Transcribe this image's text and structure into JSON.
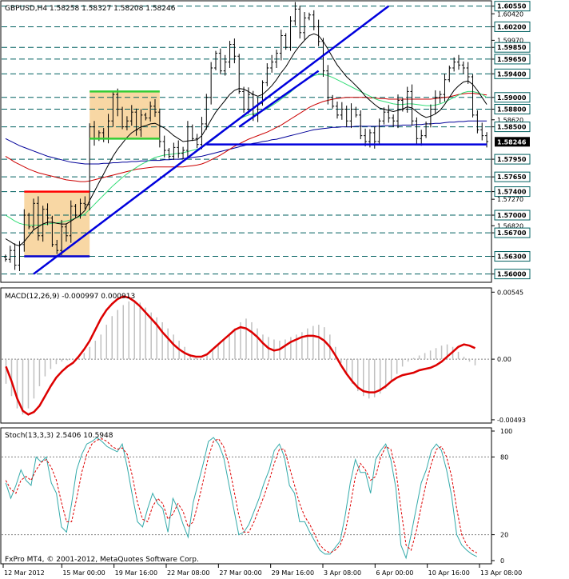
{
  "chart_data": [
    {
      "type": "candlestick",
      "symbol_label": "GBPUSD,H4",
      "ohlc_label": "1.58258 1.58327 1.58208 1.58246",
      "current_price": 1.58246,
      "current_label": "1.58246",
      "ylim": [
        1.559,
        1.606
      ],
      "y_ticks": [
        {
          "v": 1.6055,
          "label": "1.60550",
          "box": true
        },
        {
          "v": 1.6042,
          "label": "1.60420",
          "box": false
        },
        {
          "v": 1.602,
          "label": "1.60200",
          "box": true
        },
        {
          "v": 1.5997,
          "label": "1.59970",
          "box": false
        },
        {
          "v": 1.5985,
          "label": "1.59850",
          "box": true
        },
        {
          "v": 1.5965,
          "label": "1.59650",
          "box": true
        },
        {
          "v": 1.594,
          "label": "1.59400",
          "box": true
        },
        {
          "v": 1.59,
          "label": "1.59000",
          "box": true
        },
        {
          "v": 1.588,
          "label": "1.58800",
          "box": true
        },
        {
          "v": 1.5862,
          "label": "1.58620",
          "box": false
        },
        {
          "v": 1.585,
          "label": "1.58500",
          "box": true
        },
        {
          "v": 1.5795,
          "label": "1.57950",
          "box": true
        },
        {
          "v": 1.5765,
          "label": "1.57650",
          "box": true
        },
        {
          "v": 1.574,
          "label": "1.57400",
          "box": true
        },
        {
          "v": 1.5727,
          "label": "1.57270",
          "box": false
        },
        {
          "v": 1.57,
          "label": "1.57000",
          "box": true
        },
        {
          "v": 1.5682,
          "label": "1.56820",
          "box": false
        },
        {
          "v": 1.567,
          "label": "1.56700",
          "box": true
        },
        {
          "v": 1.563,
          "label": "1.56300",
          "box": true
        },
        {
          "v": 1.56,
          "label": "1.56000",
          "box": true
        }
      ],
      "horizontal_levels": [
        1.6055,
        1.602,
        1.5985,
        1.5965,
        1.594,
        1.59,
        1.588,
        1.585,
        1.5795,
        1.5765,
        1.574,
        1.57,
        1.567,
        1.563,
        1.56
      ],
      "support_line": {
        "from_bar": 43,
        "to_bar": 103,
        "price": 1.582
      },
      "trendlines": [
        {
          "bar1": 6,
          "p1": 1.56,
          "bar2": 82,
          "p2": 1.6055
        },
        {
          "bar1": 50,
          "p1": 1.585,
          "bar2": 67,
          "p2": 1.5945
        }
      ],
      "boxes": [
        {
          "bar1": 4,
          "bar2": 18,
          "top": 1.574,
          "bottom": 1.563,
          "top_color": "#ff0000",
          "bottom_color": "#0000cc"
        },
        {
          "bar1": 18,
          "bar2": 33,
          "top": 1.591,
          "bottom": 1.583,
          "top_color": "#33cc33",
          "bottom_color": "#33cc33"
        }
      ],
      "closes": [
        1.5625,
        1.564,
        1.5615,
        1.565,
        1.57,
        1.568,
        1.572,
        1.5665,
        1.571,
        1.5695,
        1.565,
        1.564,
        1.568,
        1.5665,
        1.5715,
        1.57,
        1.572,
        1.5718,
        1.585,
        1.583,
        1.584,
        1.583,
        1.586,
        1.5905,
        1.588,
        1.585,
        1.586,
        1.5875,
        1.5845,
        1.587,
        1.5865,
        1.5885,
        1.5875,
        1.5825,
        1.581,
        1.58,
        1.5815,
        1.5805,
        1.581,
        1.585,
        1.583,
        1.582,
        1.5855,
        1.59,
        1.595,
        1.5975,
        1.5945,
        1.596,
        1.599,
        1.597,
        1.591,
        1.588,
        1.5905,
        1.587,
        1.589,
        1.5925,
        1.595,
        1.596,
        1.5975,
        1.6005,
        1.5985,
        1.603,
        1.605,
        1.601,
        1.6035,
        1.604,
        1.602,
        1.5995,
        1.5945,
        1.59,
        1.5885,
        1.587,
        1.588,
        1.586,
        1.588,
        1.587,
        1.5835,
        1.5825,
        1.584,
        1.5825,
        1.586,
        1.5875,
        1.5865,
        1.586,
        1.5895,
        1.588,
        1.591,
        1.586,
        1.583,
        1.5835,
        1.5855,
        1.588,
        1.59,
        1.5905,
        1.593,
        1.595,
        1.596,
        1.5955,
        1.595,
        1.5935,
        1.587,
        1.5845,
        1.5835,
        1.5825
      ],
      "ma_fast": [
        1.566,
        1.5655,
        1.565,
        1.5648,
        1.5655,
        1.5665,
        1.5675,
        1.568,
        1.5685,
        1.5688,
        1.5688,
        1.5686,
        1.5685,
        1.5685,
        1.569,
        1.5695,
        1.57,
        1.5708,
        1.5725,
        1.574,
        1.5755,
        1.577,
        1.5785,
        1.58,
        1.5812,
        1.5822,
        1.5832,
        1.584,
        1.5845,
        1.585,
        1.5852,
        1.5855,
        1.5856,
        1.5852,
        1.5848,
        1.5842,
        1.5835,
        1.583,
        1.5825,
        1.5826,
        1.5827,
        1.5828,
        1.5835,
        1.5848,
        1.5862,
        1.5875,
        1.5885,
        1.5895,
        1.5905,
        1.5912,
        1.5915,
        1.5914,
        1.591,
        1.5905,
        1.5902,
        1.5905,
        1.5912,
        1.592,
        1.593,
        1.5942,
        1.5952,
        1.5965,
        1.5978,
        1.5988,
        1.5997,
        1.6005,
        1.6008,
        1.6005,
        1.5995,
        1.5982,
        1.5968,
        1.5955,
        1.5945,
        1.5935,
        1.5928,
        1.592,
        1.5912,
        1.5902,
        1.5895,
        1.5888,
        1.5882,
        1.588,
        1.5878,
        1.5876,
        1.5878,
        1.588,
        1.5884,
        1.5882,
        1.5876,
        1.587,
        1.5866,
        1.5868,
        1.5872,
        1.5878,
        1.5888,
        1.59,
        1.5912,
        1.592,
        1.5926,
        1.5928,
        1.5922,
        1.5912,
        1.59,
        1.5888
      ],
      "ma_mid": [
        1.57,
        1.5695,
        1.569,
        1.5686,
        1.5684,
        1.5683,
        1.5683,
        1.5683,
        1.5684,
        1.5685,
        1.5686,
        1.5687,
        1.5688,
        1.569,
        1.5692,
        1.5695,
        1.5698,
        1.5702,
        1.571,
        1.5718,
        1.5726,
        1.5734,
        1.5742,
        1.575,
        1.5757,
        1.5764,
        1.577,
        1.5776,
        1.5781,
        1.5786,
        1.579,
        1.5794,
        1.5798,
        1.58,
        1.5802,
        1.5803,
        1.5804,
        1.5805,
        1.5806,
        1.5808,
        1.581,
        1.5812,
        1.5815,
        1.582,
        1.5826,
        1.5832,
        1.5838,
        1.5845,
        1.5852,
        1.5858,
        1.5863,
        1.5867,
        1.587,
        1.5872,
        1.5874,
        1.5877,
        1.5881,
        1.5886,
        1.5891,
        1.5897,
        1.5903,
        1.5909,
        1.5916,
        1.5922,
        1.5928,
        1.5933,
        1.5937,
        1.5939,
        1.5939,
        1.5937,
        1.5934,
        1.593,
        1.5926,
        1.5922,
        1.5918,
        1.5914,
        1.591,
        1.5906,
        1.5902,
        1.5898,
        1.5895,
        1.5893,
        1.5891,
        1.5889,
        1.5888,
        1.5888,
        1.5889,
        1.5889,
        1.5888,
        1.5887,
        1.5886,
        1.5886,
        1.5887,
        1.5889,
        1.5892,
        1.5896,
        1.59,
        1.5904,
        1.5908,
        1.591,
        1.591,
        1.5908,
        1.5905,
        1.59
      ],
      "ma_slow": [
        1.58,
        1.5795,
        1.579,
        1.5786,
        1.5782,
        1.5778,
        1.5775,
        1.5772,
        1.577,
        1.5768,
        1.5766,
        1.5764,
        1.5762,
        1.576,
        1.5759,
        1.5758,
        1.5757,
        1.5757,
        1.5758,
        1.576,
        1.5762,
        1.5764,
        1.5766,
        1.5768,
        1.577,
        1.5772,
        1.5774,
        1.5776,
        1.5778,
        1.5779,
        1.578,
        1.5781,
        1.5782,
        1.5782,
        1.5782,
        1.5782,
        1.5782,
        1.5782,
        1.5782,
        1.5783,
        1.5784,
        1.5785,
        1.5787,
        1.579,
        1.5794,
        1.5798,
        1.5802,
        1.5807,
        1.5812,
        1.5817,
        1.5821,
        1.5825,
        1.5829,
        1.5832,
        1.5835,
        1.5838,
        1.5841,
        1.5845,
        1.5849,
        1.5853,
        1.5858,
        1.5863,
        1.5868,
        1.5873,
        1.5878,
        1.5883,
        1.5887,
        1.589,
        1.5893,
        1.5895,
        1.5897,
        1.5898,
        1.5899,
        1.59,
        1.59,
        1.59,
        1.59,
        1.59,
        1.5899,
        1.5899,
        1.5898,
        1.5898,
        1.5897,
        1.5897,
        1.5897,
        1.5897,
        1.5897,
        1.5897,
        1.5897,
        1.5897,
        1.5897,
        1.5897,
        1.5898,
        1.5899,
        1.59,
        1.5901,
        1.5903,
        1.5905,
        1.5906,
        1.5907,
        1.5907,
        1.5906,
        1.5905,
        1.5904
      ],
      "ma_long": [
        1.583,
        1.5826,
        1.5822,
        1.5818,
        1.5815,
        1.5812,
        1.5809,
        1.5806,
        1.5803,
        1.58,
        1.5798,
        1.5796,
        1.5794,
        1.5792,
        1.579,
        1.5789,
        1.5788,
        1.5787,
        1.5787,
        1.5787,
        1.5787,
        1.5788,
        1.5788,
        1.5789,
        1.5789,
        1.579,
        1.579,
        1.5791,
        1.5791,
        1.5792,
        1.5792,
        1.5793,
        1.5793,
        1.5793,
        1.5794,
        1.5794,
        1.5795,
        1.5795,
        1.5796,
        1.5797,
        1.5798,
        1.5799,
        1.58,
        1.5802,
        1.5804,
        1.5806,
        1.5808,
        1.581,
        1.5812,
        1.5814,
        1.5816,
        1.5818,
        1.582,
        1.5822,
        1.5823,
        1.5825,
        1.5826,
        1.5828,
        1.5829,
        1.5831,
        1.5833,
        1.5835,
        1.5837,
        1.5839,
        1.5841,
        1.5843,
        1.5845,
        1.5846,
        1.5847,
        1.5848,
        1.5849,
        1.5849,
        1.585,
        1.585,
        1.585,
        1.5851,
        1.5851,
        1.5851,
        1.5851,
        1.5851,
        1.5851,
        1.5852,
        1.5852,
        1.5852,
        1.5852,
        1.5853,
        1.5853,
        1.5853,
        1.5854,
        1.5854,
        1.5855,
        1.5855,
        1.5856,
        1.5856,
        1.5857,
        1.5858,
        1.5858,
        1.5859,
        1.5859,
        1.586,
        1.586,
        1.586,
        1.586,
        1.586
      ]
    },
    {
      "type": "bar+line",
      "label": "MACD(12,26,9) -0.000997 0.000913",
      "ylim": [
        -0.005,
        0.0056
      ],
      "y_ticks": [
        {
          "v": 0.00545,
          "label": "0.00545"
        },
        {
          "v": 0.0,
          "label": "0.00"
        },
        {
          "v": -0.00493,
          "label": "-0.00493"
        }
      ],
      "histogram": [
        -0.002,
        -0.003,
        -0.004,
        -0.0045,
        -0.004,
        -0.0032,
        -0.0022,
        -0.0014,
        -0.0008,
        -0.0004,
        -0.0002,
        -0.0001,
        0.0,
        0.0002,
        0.0005,
        0.001,
        0.0015,
        0.002,
        0.0028,
        0.0035,
        0.004,
        0.0044,
        0.0047,
        0.0048,
        0.0046,
        0.0042,
        0.0038,
        0.0034,
        0.003,
        0.0025,
        0.002,
        0.0015,
        0.001,
        0.0004,
        0.0001,
        0.0,
        0.0003,
        0.0008,
        0.0012,
        0.0016,
        0.002,
        0.0025,
        0.003,
        0.0033,
        0.003,
        0.0025,
        0.002,
        0.0018,
        0.0016,
        0.0015,
        0.0016,
        0.0018,
        0.002,
        0.0022,
        0.0025,
        0.0027,
        0.0028,
        0.0026,
        0.002,
        0.001,
        -0.0003,
        -0.0012,
        -0.002,
        -0.0026,
        -0.003,
        -0.0032,
        -0.0031,
        -0.0028,
        -0.0024,
        -0.0018,
        -0.0012,
        -0.0006,
        -0.0002,
        0.0001,
        0.0003,
        0.0005,
        0.0007,
        0.0009,
        0.0011,
        0.0012,
        0.001,
        0.0006,
        0.0002,
        -0.0002,
        -0.0005
      ],
      "signal": [
        -0.0006,
        -0.0018,
        -0.0032,
        -0.0042,
        -0.0045,
        -0.0043,
        -0.0038,
        -0.003,
        -0.0022,
        -0.0015,
        -0.001,
        -0.0006,
        -0.0003,
        0.0002,
        0.0008,
        0.0015,
        0.0024,
        0.0033,
        0.004,
        0.0045,
        0.0049,
        0.0051,
        0.005,
        0.0047,
        0.0043,
        0.0038,
        0.0033,
        0.0028,
        0.0022,
        0.0017,
        0.0012,
        0.0008,
        0.0005,
        0.0003,
        0.0002,
        0.0002,
        0.0004,
        0.0008,
        0.0012,
        0.0016,
        0.002,
        0.0024,
        0.0026,
        0.0025,
        0.0022,
        0.0018,
        0.0013,
        0.0009,
        0.0007,
        0.0008,
        0.0011,
        0.0014,
        0.0016,
        0.0018,
        0.0019,
        0.0019,
        0.0018,
        0.0015,
        0.001,
        0.0003,
        -0.0005,
        -0.0012,
        -0.0018,
        -0.0023,
        -0.0026,
        -0.0027,
        -0.0027,
        -0.0025,
        -0.0022,
        -0.0018,
        -0.0015,
        -0.0013,
        -0.0012,
        -0.0011,
        -0.0009,
        -0.0008,
        -0.0007,
        -0.0005,
        -0.0002,
        0.0002,
        0.0006,
        0.001,
        0.0012,
        0.0011,
        0.0009
      ]
    },
    {
      "type": "line",
      "label": "Stoch(13,3,3) 2.5406 10.5948",
      "ylim": [
        0,
        100
      ],
      "y_ticks": [
        {
          "v": 100,
          "label": "100"
        },
        {
          "v": 80,
          "label": "80"
        },
        {
          "v": 20,
          "label": "20"
        },
        {
          "v": 0,
          "label": "0"
        }
      ],
      "levels": [
        80,
        20
      ],
      "main": [
        60,
        48,
        58,
        70,
        62,
        58,
        80,
        76,
        80,
        60,
        52,
        26,
        22,
        44,
        70,
        82,
        90,
        92,
        95,
        92,
        88,
        86,
        84,
        90,
        72,
        50,
        30,
        26,
        40,
        52,
        44,
        40,
        22,
        48,
        40,
        28,
        18,
        45,
        60,
        75,
        92,
        95,
        90,
        80,
        60,
        40,
        20,
        22,
        28,
        38,
        48,
        60,
        70,
        85,
        90,
        80,
        58,
        52,
        30,
        30,
        22,
        15,
        8,
        5,
        5,
        10,
        15,
        35,
        60,
        78,
        68,
        68,
        52,
        78,
        85,
        90,
        78,
        56,
        12,
        2,
        20,
        40,
        60,
        70,
        85,
        90,
        85,
        70,
        50,
        20,
        12,
        8,
        5,
        3
      ],
      "signal": [
        62,
        55,
        52,
        62,
        65,
        62,
        70,
        76,
        78,
        72,
        62,
        45,
        30,
        30,
        48,
        68,
        82,
        90,
        93,
        94,
        92,
        88,
        86,
        87,
        82,
        65,
        45,
        32,
        30,
        42,
        48,
        44,
        32,
        36,
        44,
        38,
        26,
        30,
        45,
        62,
        80,
        92,
        94,
        88,
        75,
        55,
        35,
        22,
        22,
        30,
        40,
        50,
        62,
        75,
        86,
        86,
        72,
        58,
        44,
        34,
        28,
        20,
        12,
        8,
        6,
        8,
        12,
        22,
        42,
        65,
        75,
        70,
        62,
        65,
        80,
        88,
        86,
        70,
        40,
        12,
        8,
        22,
        42,
        60,
        75,
        86,
        88,
        80,
        65,
        40,
        20,
        12,
        8,
        6
      ]
    }
  ],
  "x_axis_labels": [
    "12 Mar 2012",
    "15 Mar 00:00",
    "19 Mar 16:00",
    "22 Mar 08:00",
    "27 Mar 00:00",
    "29 Mar 16:00",
    "3 Apr 08:00",
    "6 Apr 00:00",
    "10 Apr 16:00",
    "13 Apr 08:00"
  ],
  "footer_text": "FxPro MT4, © 2001-2012, MetaQuotes Software Corp.",
  "colors": {
    "bars": "#000000",
    "levels": "#006060",
    "trendline": "#0000dd",
    "box_fill": "#f8d7a4",
    "ma_fast": "#000000",
    "ma_mid": "#33dd77",
    "ma_red": "#cc0000",
    "ma_blue": "#000099",
    "macd_hist": "#c0c0c0",
    "macd_signal": "#dd0000",
    "stoch_main": "#33aaaa",
    "stoch_signal": "#dd0000"
  }
}
